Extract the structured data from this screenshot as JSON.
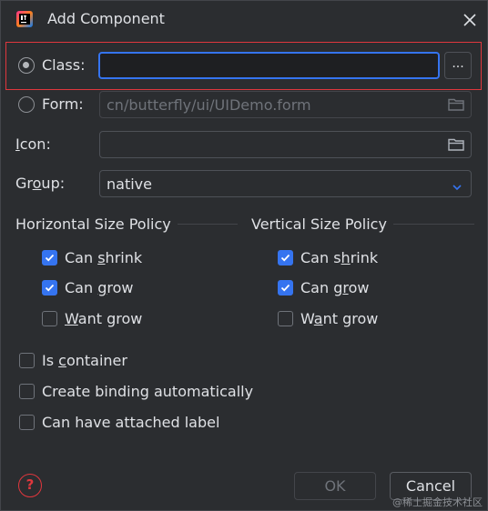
{
  "dialog": {
    "title": "Add Component",
    "icon": "intellij-idea-icon",
    "close_icon": "close-icon"
  },
  "source": {
    "class_label": "Class:",
    "class_value": "",
    "class_selected": true,
    "browse_label": "...",
    "form_label": "Form:",
    "form_placeholder": "cn/butterfly/ui/UIDemo.form",
    "form_selected": false
  },
  "icon_field": {
    "label": "Icon:",
    "value": ""
  },
  "group": {
    "label": "Group:",
    "selected": "native"
  },
  "horizontal_policy": {
    "title": "Horizontal Size Policy",
    "can_shrink": {
      "label": "Can shrink",
      "checked": true
    },
    "can_grow": {
      "label": "Can grow",
      "checked": true
    },
    "want_grow": {
      "label": "Want grow",
      "checked": false
    }
  },
  "vertical_policy": {
    "title": "Vertical Size Policy",
    "can_shrink": {
      "label": "Can shrink",
      "checked": true
    },
    "can_grow": {
      "label": "Can grow",
      "checked": true
    },
    "want_grow": {
      "label": "Want grow",
      "checked": false
    }
  },
  "options": {
    "is_container": {
      "label": "Is container",
      "checked": false
    },
    "create_binding": {
      "label": "Create binding automatically",
      "checked": false
    },
    "attached_label": {
      "label": "Can have attached label",
      "checked": false
    }
  },
  "footer": {
    "help_label": "?",
    "ok_label": "OK",
    "cancel_label": "Cancel",
    "watermark": "@稀土掘金技术社区"
  },
  "colors": {
    "background": "#2b2d30",
    "accent": "#3574f0",
    "highlight": "#e0373d",
    "text": "#dfe1e5",
    "muted": "#6f737a"
  }
}
